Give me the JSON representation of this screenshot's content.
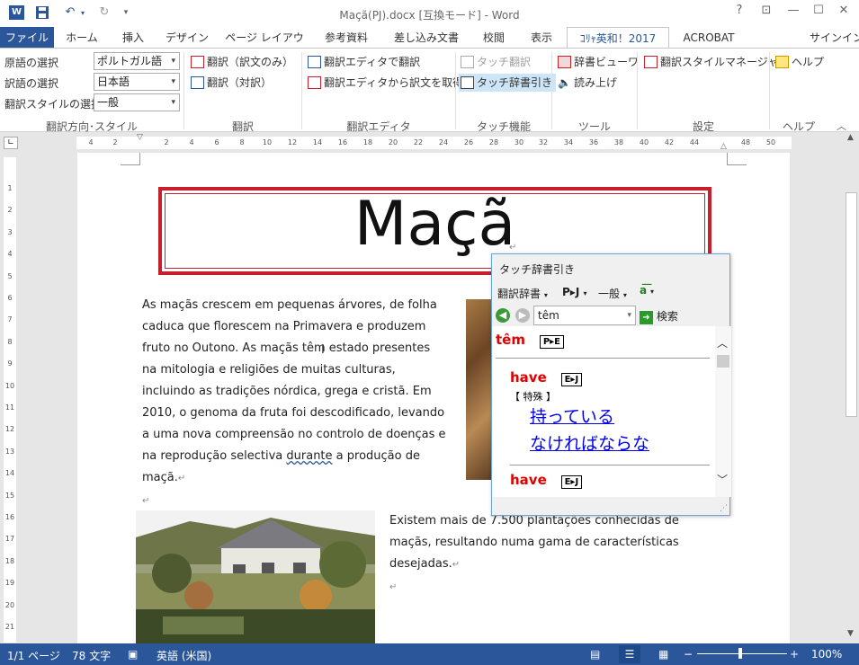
{
  "window": {
    "title": "Maçã(PJ).docx [互換モード] - Word",
    "help_btn": "?",
    "restore_ribbon_btn": "⊡",
    "minimize_btn": "—",
    "maximize_btn": "☐",
    "close_btn": "✕"
  },
  "tabs": [
    "ファイル",
    "ホーム",
    "挿入",
    "デザイン",
    "ページ レイアウト",
    "参考資料",
    "差し込み文書",
    "校閲",
    "表示",
    "ｺﾘｬ英和！2017",
    "ACROBAT"
  ],
  "signin": "サインイン",
  "ribbon": {
    "source_lang_label": "原語の選択",
    "source_lang_value": "ポルトガル語",
    "target_lang_label": "訳語の選択",
    "target_lang_value": "日本語",
    "style_label": "翻訳スタイルの選択",
    "style_value": "一般",
    "group_direction": "翻訳方向･スタイル",
    "translate_only": "翻訳（訳文のみ）",
    "translate_pair": "翻訳（対訳）",
    "group_translate": "翻訳",
    "editor_translate": "翻訳エディタで翻訳",
    "editor_get": "翻訳エディタから訳文を取得",
    "group_editor": "翻訳エディタ",
    "touch_translate": "タッチ翻訳",
    "touch_dict": "タッチ辞書引き",
    "group_touch": "タッチ機能",
    "dict_viewer": "辞書ビューワ",
    "read_aloud": "読み上げ",
    "group_tools": "ツール",
    "style_manager": "翻訳スタイルマネージャ",
    "group_settings": "設定",
    "help": "ヘルプ",
    "group_help": "ヘルプ"
  },
  "ruler_numbers": [
    "4",
    "2",
    "2",
    "4",
    "6",
    "8",
    "10",
    "12",
    "14",
    "16",
    "18",
    "20",
    "22",
    "24",
    "26",
    "28",
    "30",
    "32",
    "34",
    "36",
    "38",
    "40",
    "42",
    "44",
    "48",
    "50"
  ],
  "vruler_numbers": [
    "1",
    "2",
    "3",
    "4",
    "5",
    "6",
    "7",
    "8",
    "9",
    "10",
    "11",
    "12",
    "13",
    "14",
    "15",
    "16",
    "17",
    "18",
    "19",
    "20",
    "21"
  ],
  "document": {
    "title": "Maçã",
    "para1_lines": [
      "As maçãs crescem em pequenas árvores, de folha",
      "caduca que florescem na Primavera e produzem",
      "fruto no Outono. As maçãs têm estado presentes",
      "na mitologia e religiões de muitas culturas,",
      "incluindo as tradições nórdica, grega e cristã. Em",
      "2010, o genoma da fruta foi descodificado, levando",
      "a uma nova compreensão no controlo de doenças e",
      "na reprodução selectiva"
    ],
    "para1_underlined": "durante",
    "para1_end": "a produção de",
    "para1_last": "maçã.",
    "para2_lines": [
      "Existem mais de 7.500 plantações conhecidas de",
      "maçãs, resultando numa gama de características",
      "desejadas."
    ]
  },
  "popup": {
    "title": "タッチ辞書引き",
    "dict_menu": "翻訳辞書",
    "pj_menu": "P▸J",
    "style_menu": "一般",
    "search_value": "têm",
    "search_button": "検索",
    "headword": "têm",
    "headword_badge": "P▸E",
    "entry1_word": "have",
    "entry1_badge": "E▸J",
    "entry1_tag": "【 特殊 】",
    "entry1_sense1": "持っている",
    "entry1_sense2": "なければならな",
    "entry2_word": "have",
    "entry2_badge": "E▸J"
  },
  "status": {
    "page": "1/1 ページ",
    "words": "78 文字",
    "language": "英語 (米国)",
    "zoom": "100%",
    "zoom_minus": "−",
    "zoom_plus": "+"
  },
  "colors": {
    "accent": "#2b579a",
    "title_border": "#c8202b",
    "dict_red": "#e00000",
    "link_blue": "#0000ee"
  }
}
